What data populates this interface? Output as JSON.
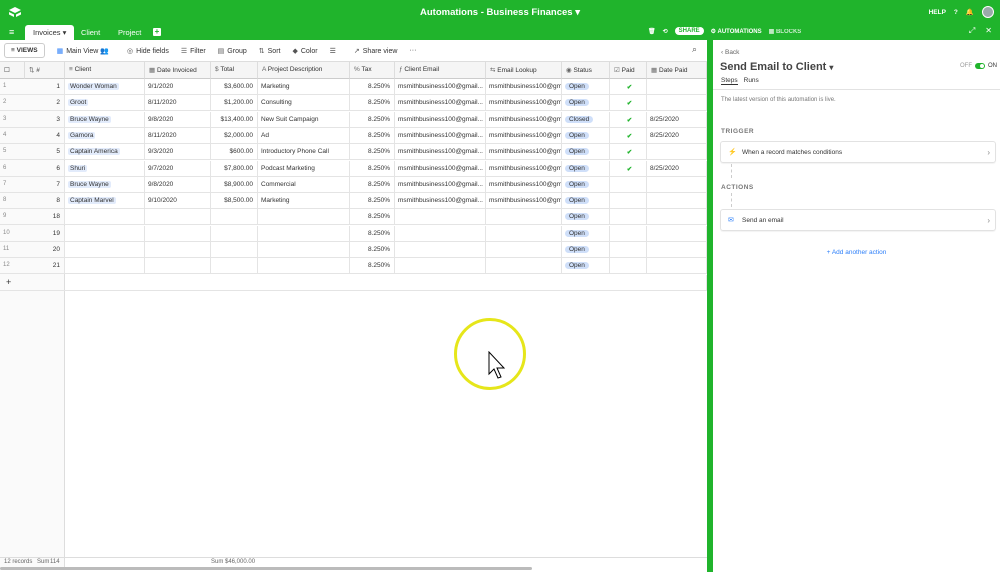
{
  "app": {
    "title": "Automations - Business Finances",
    "help": "HELP"
  },
  "tabs": [
    {
      "label": "Invoices",
      "active": true
    },
    {
      "label": "Client",
      "active": false
    },
    {
      "label": "Project",
      "active": false
    }
  ],
  "topright": {
    "share": "SHARE",
    "automations": "AUTOMATIONS",
    "blocks": "BLOCKS"
  },
  "toolbar": {
    "views": "VIEWS",
    "view_name": "Main View",
    "hide_fields": "Hide fields",
    "filter": "Filter",
    "group": "Group",
    "sort": "Sort",
    "color": "Color",
    "share_view": "Share view"
  },
  "columns": [
    "#",
    "Client",
    "Date Invoiced",
    "Total",
    "Project Description",
    "Tax",
    "Client Email",
    "Email Lookup",
    "Status",
    "Paid",
    "Date Paid"
  ],
  "rows": [
    {
      "n": "1",
      "id": "1",
      "client": "Wonder Woman",
      "date": "9/1/2020",
      "total": "$3,600.00",
      "desc": "Marketing",
      "tax": "8.250%",
      "email": "msmithbusiness100@gmail...",
      "lookup": "msmithbusiness100@gmai...",
      "status": "Open",
      "paid": true,
      "date_paid": ""
    },
    {
      "n": "2",
      "id": "2",
      "client": "Groot",
      "date": "8/11/2020",
      "total": "$1,200.00",
      "desc": "Consulting",
      "tax": "8.250%",
      "email": "msmithbusiness100@gmail...",
      "lookup": "msmithbusiness100@gmai...",
      "status": "Open",
      "paid": true,
      "date_paid": ""
    },
    {
      "n": "3",
      "id": "3",
      "client": "Bruce Wayne",
      "date": "9/8/2020",
      "total": "$13,400.00",
      "desc": "New Suit Campaign",
      "tax": "8.250%",
      "email": "msmithbusiness100@gmail...",
      "lookup": "msmithbusiness100@gmai...",
      "status": "Closed",
      "paid": true,
      "date_paid": "8/25/2020"
    },
    {
      "n": "4",
      "id": "4",
      "client": "Gamora",
      "date": "8/11/2020",
      "total": "$2,000.00",
      "desc": "Ad",
      "tax": "8.250%",
      "email": "msmithbusiness100@gmail...",
      "lookup": "msmithbusiness100@gmai...",
      "status": "Open",
      "paid": true,
      "date_paid": "8/25/2020"
    },
    {
      "n": "5",
      "id": "5",
      "client": "Captain America",
      "date": "9/3/2020",
      "total": "$600.00",
      "desc": "Introductory Phone Call",
      "tax": "8.250%",
      "email": "msmithbusiness100@gmail...",
      "lookup": "msmithbusiness100@gmai...",
      "status": "Open",
      "paid": true,
      "date_paid": ""
    },
    {
      "n": "6",
      "id": "6",
      "client": "Shuri",
      "date": "9/7/2020",
      "total": "$7,800.00",
      "desc": "Podcast Marketing",
      "tax": "8.250%",
      "email": "msmithbusiness100@gmail...",
      "lookup": "msmithbusiness100@gmai...",
      "status": "Open",
      "paid": true,
      "date_paid": "8/25/2020"
    },
    {
      "n": "7",
      "id": "7",
      "client": "Bruce Wayne",
      "date": "9/8/2020",
      "total": "$8,900.00",
      "desc": "Commercial",
      "tax": "8.250%",
      "email": "msmithbusiness100@gmail...",
      "lookup": "msmithbusiness100@gmai...",
      "status": "Open",
      "paid": false,
      "date_paid": ""
    },
    {
      "n": "8",
      "id": "8",
      "client": "Captain Marvel",
      "date": "9/10/2020",
      "total": "$8,500.00",
      "desc": "Marketing",
      "tax": "8.250%",
      "email": "msmithbusiness100@gmail...",
      "lookup": "msmithbusiness100@gmai...",
      "status": "Open",
      "paid": false,
      "date_paid": ""
    },
    {
      "n": "9",
      "id": "18",
      "client": "",
      "date": "",
      "total": "",
      "desc": "",
      "tax": "8.250%",
      "email": "",
      "lookup": "",
      "status": "Open",
      "paid": false,
      "date_paid": ""
    },
    {
      "n": "10",
      "id": "19",
      "client": "",
      "date": "",
      "total": "",
      "desc": "",
      "tax": "8.250%",
      "email": "",
      "lookup": "",
      "status": "Open",
      "paid": false,
      "date_paid": ""
    },
    {
      "n": "11",
      "id": "20",
      "client": "",
      "date": "",
      "total": "",
      "desc": "",
      "tax": "8.250%",
      "email": "",
      "lookup": "",
      "status": "Open",
      "paid": false,
      "date_paid": ""
    },
    {
      "n": "12",
      "id": "21",
      "client": "",
      "date": "",
      "total": "",
      "desc": "",
      "tax": "8.250%",
      "email": "",
      "lookup": "",
      "status": "Open",
      "paid": false,
      "date_paid": ""
    }
  ],
  "footer": {
    "records": "12 records",
    "sum_label": "Sum",
    "sum_id": "114",
    "sum_total": "Sum $46,000.00"
  },
  "panel": {
    "back": "Back",
    "title": "Send Email to Client",
    "toggle_off": "OFF",
    "toggle_on": "ON",
    "tab_steps": "Steps",
    "tab_runs": "Runs",
    "note": "The latest version of this automation is live.",
    "trigger_label": "TRIGGER",
    "trigger": "When a record matches conditions",
    "actions_label": "ACTIONS",
    "action": "Send an email",
    "add_action": "+ Add another action"
  },
  "colors": {
    "brand": "#20b42c",
    "status_bg": "#cfdff9",
    "chip_bg": "#e2ebfb",
    "link": "#2d7ff9"
  }
}
